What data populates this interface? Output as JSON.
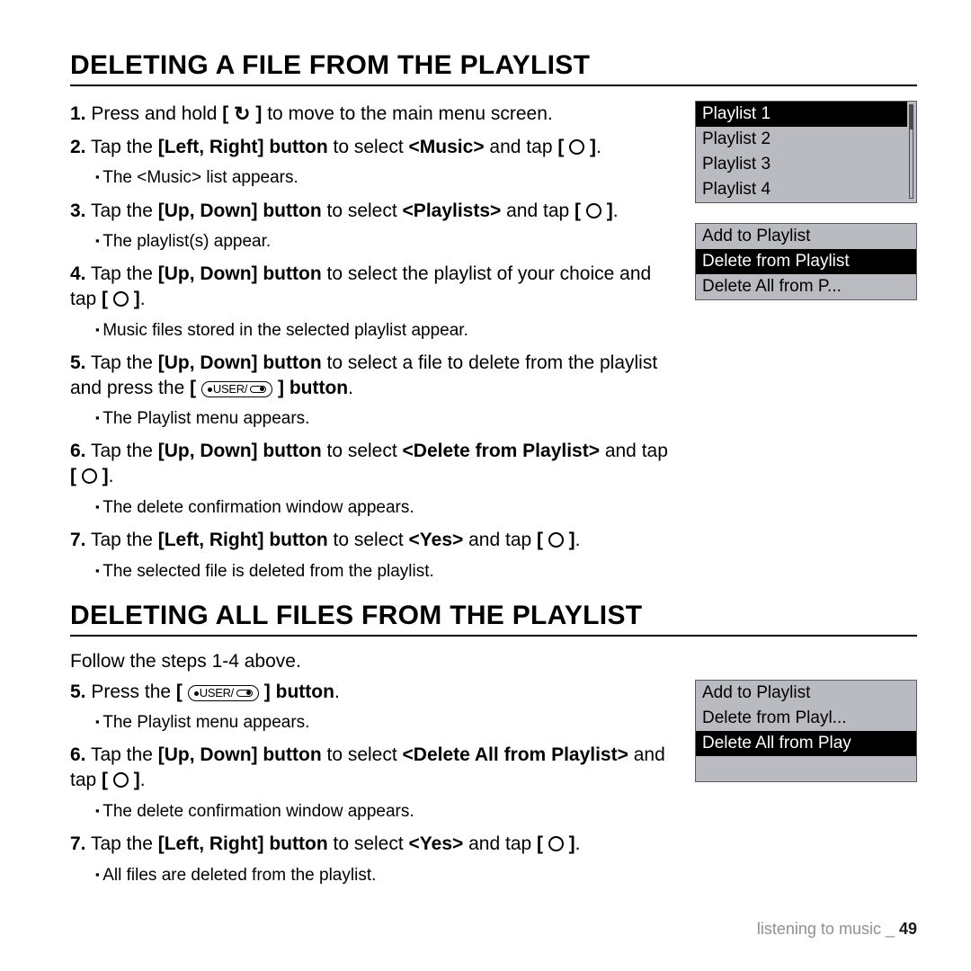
{
  "section1": {
    "title": "DELETING A FILE FROM THE PLAYLIST",
    "steps": {
      "s1_num": "1.",
      "s1a": "Press and hold ",
      "s1b": " to move to the main menu screen.",
      "s2_num": "2.",
      "s2a": "Tap the ",
      "s2b": "Left, Right] button",
      "s2c": " to select ",
      "s2d": "<Music>",
      "s2e": " and tap ",
      "s2_sub": "The <Music> list appears.",
      "s3_num": "3.",
      "s3a": "Tap the ",
      "s3b": "[Up, Down] button",
      "s3c": " to select ",
      "s3d": "<Playlists>",
      "s3e": " and tap ",
      "s3_sub": "The playlist(s) appear.",
      "s4_num": "4.",
      "s4a": "Tap the ",
      "s4b": "[Up, Down] button",
      "s4c": " to select the playlist of your choice and tap ",
      "s4_sub": "Music files stored in the selected playlist appear.",
      "s5_num": "5.",
      "s5a": "Tap the ",
      "s5b": "[Up, Down] button",
      "s5c": " to select a file to delete from the playlist and press the ",
      "s5d": " button",
      "s5_sub": "The Playlist menu appears.",
      "s6_num": "6.",
      "s6a": "Tap the ",
      "s6b": "[Up, Down] button",
      "s6c": " to select ",
      "s6d": "<Delete from Playlist>",
      "s6e": " and tap ",
      "s6_sub": "The delete confirmation window appears.",
      "s7_num": "7.",
      "s7a": "Tap the ",
      "s7b": "[Left, Right] button",
      "s7c": " to select ",
      "s7d": "<Yes>",
      "s7e": " and tap ",
      "s7_sub": "The selected file is deleted from the playlist."
    },
    "screen1": {
      "r1": "Playlist 1",
      "r2": "Playlist 2",
      "r3": "Playlist 3",
      "r4": "Playlist 4"
    },
    "screen2": {
      "r1": "Add to Playlist",
      "r2": "Delete from Playlist",
      "r3": "Delete All from P..."
    }
  },
  "section2": {
    "title": "DELETING ALL FILES FROM THE PLAYLIST",
    "follow": "Follow the steps 1-4 above.",
    "steps": {
      "s5_num": "5.",
      "s5a": "Press the ",
      "s5b": " button",
      "s5_sub": "The Playlist menu appears.",
      "s6_num": "6.",
      "s6a": "Tap the ",
      "s6b": "[Up, Down] button",
      "s6c": " to select ",
      "s6d": "<Delete All from Playlist>",
      "s6e": " and tap ",
      "s6_sub": "The delete confirmation window appears.",
      "s7_num": "7.",
      "s7a": "Tap the ",
      "s7b": "[Left, Right] button",
      "s7c": " to select ",
      "s7d": "<Yes>",
      "s7e": " and tap ",
      "s7_sub": "All files are deleted from the playlist."
    },
    "screen": {
      "r1": "Add to Playlist",
      "r2": "Delete from Playl...",
      "r3": "Delete All from Play"
    }
  },
  "footer": {
    "text": "listening to music _ ",
    "page": "49"
  },
  "user_label": "USER/"
}
